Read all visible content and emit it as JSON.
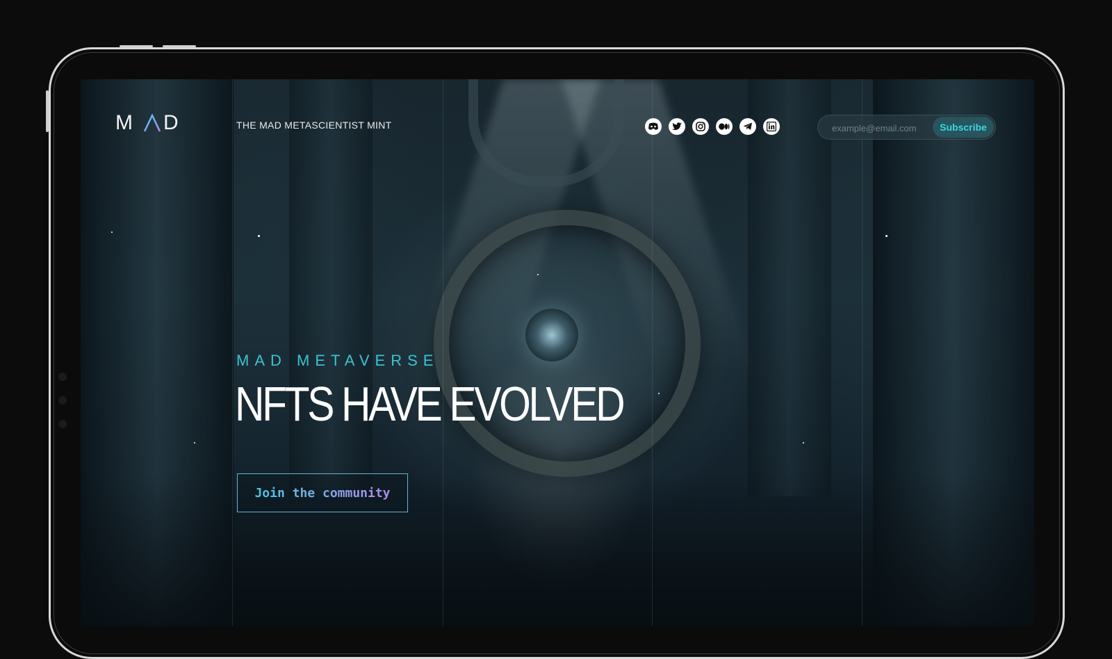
{
  "header": {
    "logo_left": "M",
    "logo_right": "D",
    "tagline": "THE MAD METASCIENTIST MINT"
  },
  "socials": [
    {
      "icon": "discord-icon"
    },
    {
      "icon": "twitter-icon"
    },
    {
      "icon": "instagram-icon"
    },
    {
      "icon": "medium-icon"
    },
    {
      "icon": "telegram-icon"
    },
    {
      "icon": "linkedin-icon"
    }
  ],
  "subscribe": {
    "placeholder": "example@email.com",
    "button_label": "Subscribe"
  },
  "hero": {
    "eyebrow": "MAD METAVERSE",
    "headline": "NFTS HAVE EVOLVED",
    "cta_label": "Join the community"
  },
  "colors": {
    "accent_cyan": "#3cc3cf",
    "accent_purple": "#b48be8",
    "subscribe_text": "#3ad6e0"
  }
}
